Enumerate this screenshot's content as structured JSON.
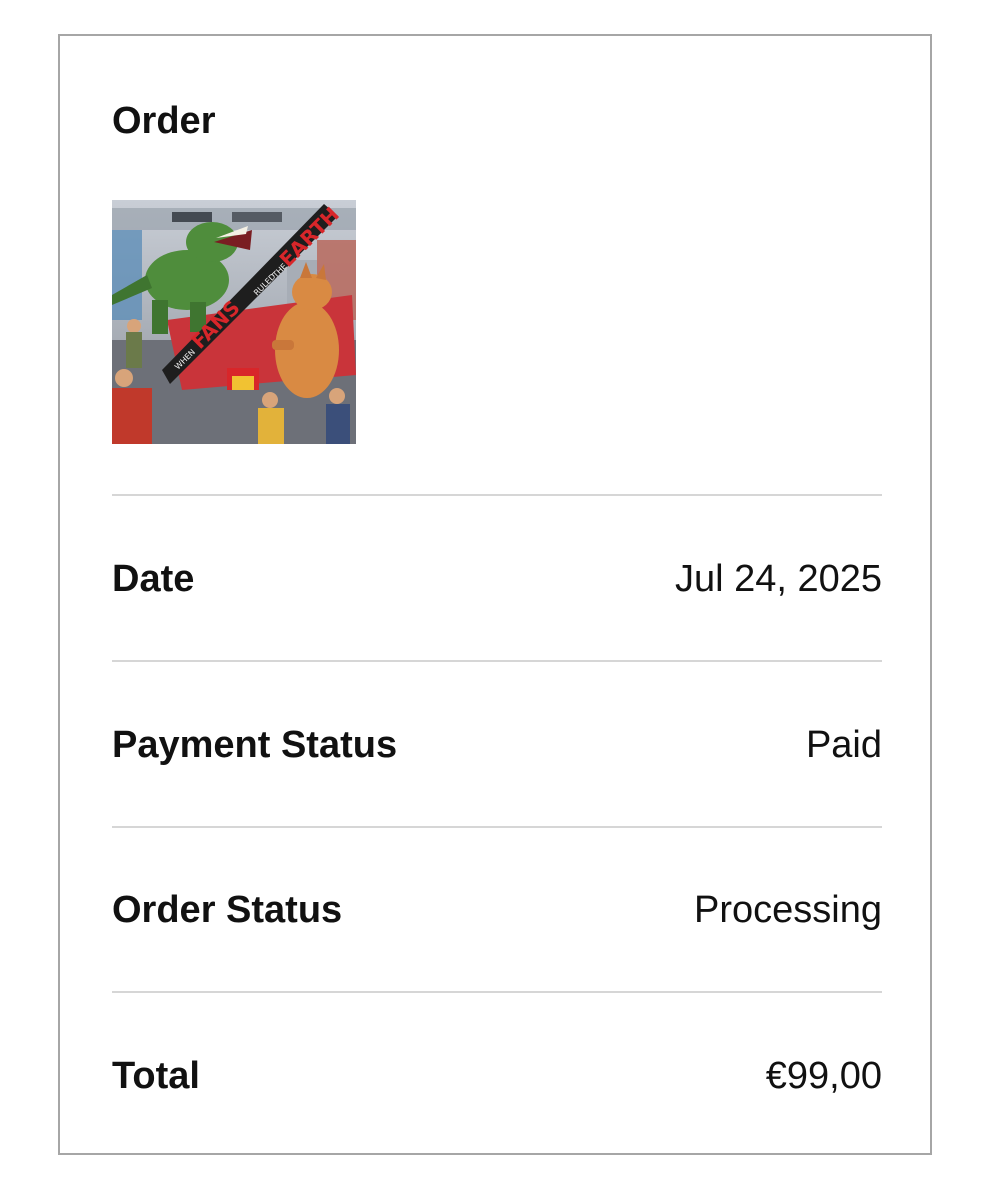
{
  "order": {
    "heading": "Order",
    "image": {
      "alt": "",
      "banner_text": [
        "WHEN",
        "FANS",
        "RULED",
        "THE",
        "EARTH"
      ],
      "colors": {
        "banner": "#1e1e1e",
        "banner_text_red": "#d8262a",
        "banner_text_white": "#f2f2f2",
        "carpet": "#c9343a",
        "trex": "#4f8d3c",
        "orange_dino": "#d98a43"
      }
    },
    "rows": [
      {
        "label": "Date",
        "value": "Jul 24, 2025"
      },
      {
        "label": "Payment Status",
        "value": "Paid"
      },
      {
        "label": "Order Status",
        "value": "Processing"
      },
      {
        "label": "Total",
        "value": "€99,00"
      }
    ]
  },
  "colors": {
    "card_border": "#a6a6a6",
    "divider": "#d6d6d6",
    "text": "#111111",
    "background": "#ffffff"
  }
}
